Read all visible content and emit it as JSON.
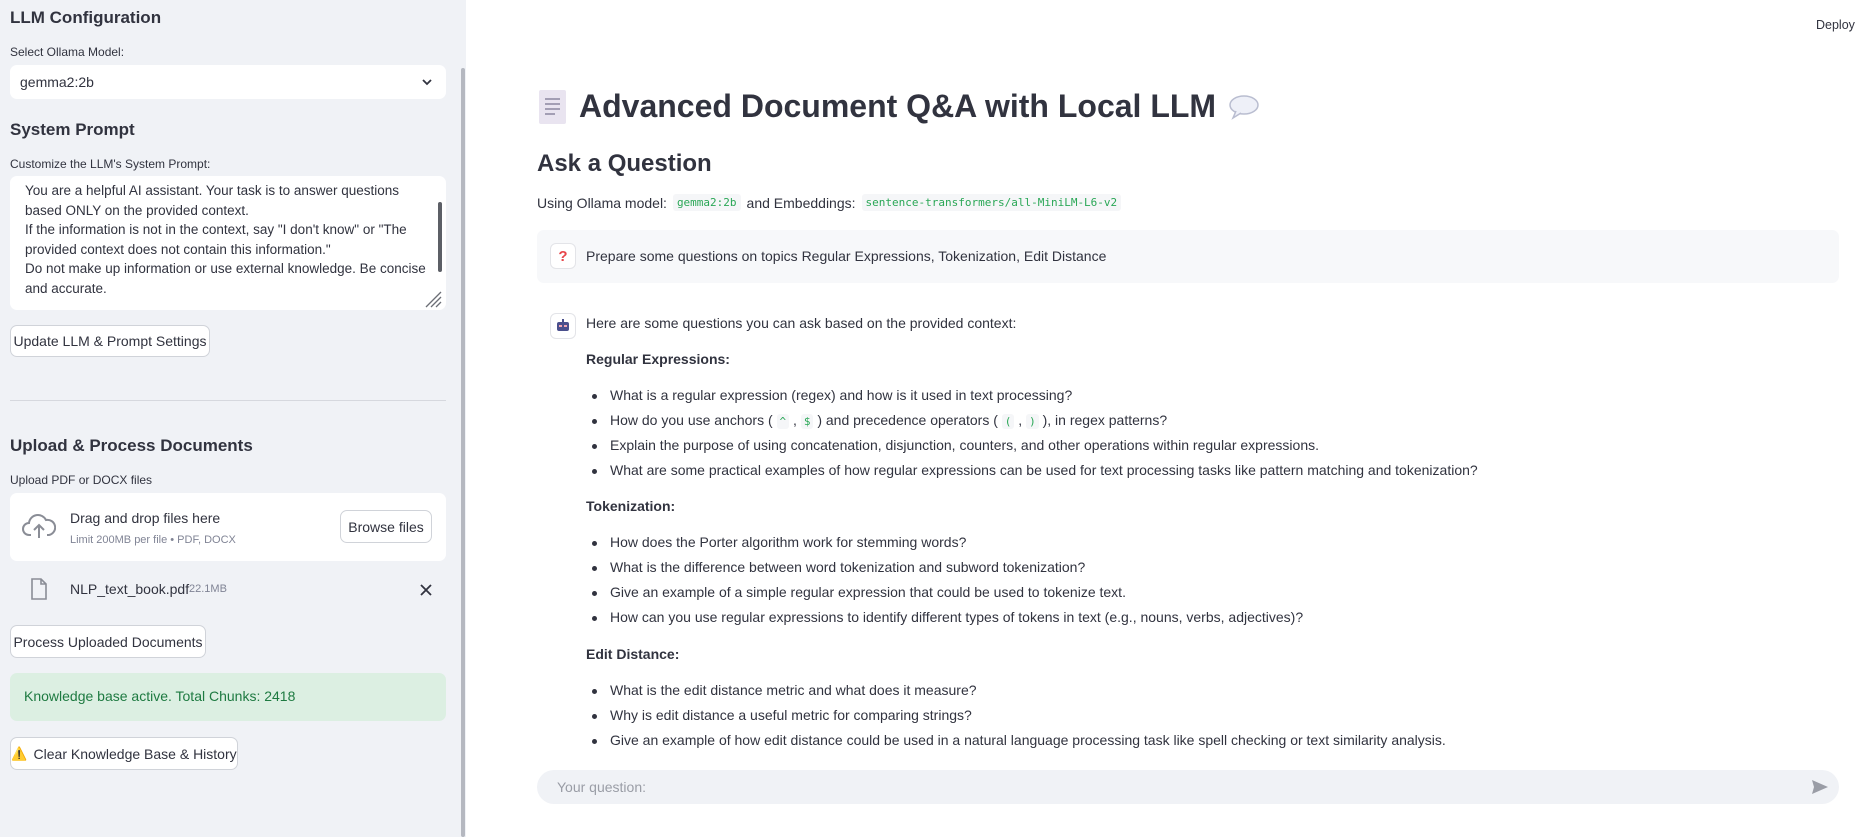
{
  "sidebar": {
    "llm_title": "LLM Configuration",
    "model_label": "Select Ollama Model:",
    "model_value": "gemma2:2b",
    "system_prompt_title": "System Prompt",
    "system_prompt_label": "Customize the LLM's System Prompt:",
    "system_prompt_value": "You are a helpful AI assistant. Your task is to answer questions based ONLY on the provided context.\nIf the information is not in the context, say \"I don't know\" or \"The provided context does not contain this information.\"\nDo not make up information or use external knowledge. Be concise and accurate.",
    "update_button": "Update LLM & Prompt Settings",
    "upload_title": "Upload & Process Documents",
    "upload_label": "Upload PDF or DOCX files",
    "dropzone_title": "Drag and drop files here",
    "dropzone_sub": "Limit 200MB per file • PDF, DOCX",
    "browse_button": "Browse files",
    "file_name": "NLP_text_book.pdf",
    "file_size": "22.1MB",
    "process_button": "Process Uploaded Documents",
    "status_text": "Knowledge base active. Total Chunks: 2418",
    "clear_button": "Clear Knowledge Base & History"
  },
  "header": {
    "deploy": "Deploy"
  },
  "main": {
    "title": "Advanced Document Q&A with Local LLM",
    "subheader": "Ask a Question",
    "using_prefix": "Using Ollama model:",
    "model_code": "gemma2:2b",
    "embed_prefix": "and Embeddings:",
    "embed_code": "sentence-transformers/all-MiniLM-L6-v2",
    "user_message": "Prepare some questions on topics Regular Expressions, Tokenization, Edit Distance",
    "assistant_intro": "Here are some questions you can ask based on the provided context:",
    "sections": [
      {
        "heading": "Regular Expressions:",
        "items": [
          "What is a regular expression (regex) and how is it used in text processing?",
          "How do you use anchors ( ^ , $ ) and precedence operators ( ( , ) ), in regex patterns?",
          "Explain the purpose of using concatenation, disjunction, counters, and other operations within regular expressions.",
          "What are some practical examples of how regular expressions can be used for text processing tasks like pattern matching and tokenization?"
        ]
      },
      {
        "heading": "Tokenization:",
        "items": [
          "How does the Porter algorithm work for stemming words?",
          "What is the difference between word tokenization and subword tokenization?",
          "Give an example of a simple regular expression that could be used to tokenize text.",
          "How can you use regular expressions to identify different types of tokens in text (e.g., nouns, verbs, adjectives)?"
        ]
      },
      {
        "heading": "Edit Distance:",
        "items": [
          "What is the edit distance metric and what does it measure?",
          "Why is edit distance a useful metric for comparing strings?",
          "Give an example of how edit distance could be used in a natural language processing task like spell checking or text similarity analysis."
        ]
      }
    ],
    "input_placeholder": "Your question:"
  },
  "colors": {
    "sidebar_bg": "#f0f2f6",
    "code_green": "#2aa756",
    "success_bg": "#dcefe2",
    "success_text": "#1e7a41",
    "user_avatar": "#e8464a"
  }
}
